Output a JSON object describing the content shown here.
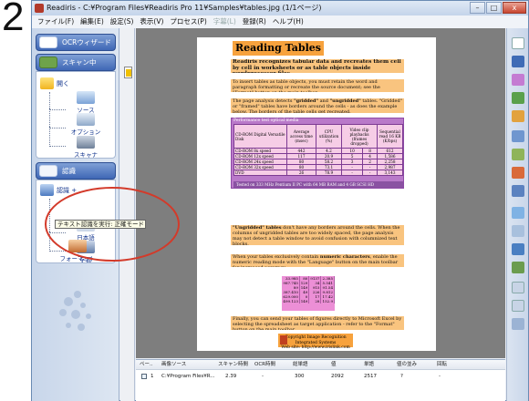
{
  "step_number": "2",
  "window": {
    "title": "Readiris - C:¥Program Files¥Readiris Pro 11¥Samples¥tables.jpg (1/1ページ)",
    "buttons": {
      "minimize": "–",
      "maximize": "□",
      "close": "x"
    }
  },
  "menu": {
    "items": [
      {
        "label": "ファイル(F)"
      },
      {
        "label": "編集(E)"
      },
      {
        "label": "設定(S)"
      },
      {
        "label": "表示(V)"
      },
      {
        "label": "プロセス(P)"
      },
      {
        "label": "字幕(L)"
      },
      {
        "label": "登録(R)"
      },
      {
        "label": "ヘルプ(H)"
      }
    ]
  },
  "left_panel": {
    "ocr_wizard": "OCRウィザード",
    "scan_section": "スキャン中",
    "scan_open": "開く",
    "scan_tree": [
      "ソース",
      "オプション",
      "スキャナ"
    ],
    "recognize_section": "認識",
    "recognize_button": "認識 +",
    "recognize_tree": [
      "日本語",
      "学習"
    ],
    "format_item": "フォーマット",
    "tooltip": "テキスト認識を実行: 正確モード"
  },
  "document": {
    "title": "Reading Tables",
    "intro": "Readiris recognizes tabular data and recreates them cell by cell in worksheets or as table objects inside wordprocessor files.",
    "para1": "To insert tables as table objects, you must retain the word and paragraph formatting or recreate the source document; see the \"Format\" button on the main toolbar.",
    "para2_a": "The page analysis detects ",
    "para2_b": "\"gridded\"",
    "para2_c": " and ",
    "para2_d": "\"ungridded\"",
    "para2_e": " tables. \"Gridded\" or \"framed\" tables have borders around the cells - as does the example below. The borders of the table cells get recreated.",
    "table": {
      "caption": "Performance test optical media",
      "headers": [
        "CD-ROM Digital Versatile Disk",
        "Average access time (msec)",
        "CPU utilization (%)",
        "Video clip playbacks (frames dropped)",
        "",
        "Sequential read 16 KB (K/bps)"
      ],
      "rows": [
        [
          "CD-ROM 8x speed",
          "442",
          "4.2",
          "10",
          "8",
          "612"
        ],
        [
          "CD-ROM 12x speed",
          "117",
          "20.9",
          "5",
          "4",
          "1,586"
        ],
        [
          "CD-ROM 24x speed",
          "80",
          "58.2",
          "3",
          "2",
          "2,258"
        ],
        [
          "CD-ROM 32x speed",
          "80",
          "73.1",
          "-",
          "-",
          "2,987"
        ],
        [
          "DVD",
          "26",
          "78.9",
          "-",
          "-",
          "3,143"
        ]
      ],
      "footer": "Tested on 333 MHz Pentium II PC with 64 MB RAM and 4 GB SCSI HD"
    },
    "para3_a": "\"Ungridded\" tables",
    "para3_b": " don't have any borders around the cells. When the columns of ungridded tables are too widely spaced, the page analysis may not detect a table window to avoid confusion with columnized text blocks.",
    "para4_a": "When your tables exclusively contain ",
    "para4_b": "numeric characters",
    "para4_c": ", enable the numeric reading mode with the \"Language\" button on the main toolbar for increased accuracy.",
    "numbers": [
      [
        "33.985",
        "80",
        "9137",
        "2.385"
      ],
      [
        "987.745",
        "129",
        "34",
        "5.541"
      ],
      [
        "89",
        "149",
        "915",
        "91.54"
      ],
      [
        "387.410",
        "49",
        "226",
        "9.812"
      ],
      [
        "629.000",
        "0",
        "17",
        "17.42"
      ],
      [
        "499.123",
        "149",
        "28",
        "152.9"
      ]
    ],
    "para5": "Finally, you can send your tables of figures directly to Microsoft Excel by selecting the spreadsheet as target application - refer to the \"Format\" button on the main toolbar.",
    "footer_line1": "Copyright Image Recognition Integrated Systems",
    "footer_line2": "Web site: http://www.irislink.com"
  },
  "results": {
    "headers": [
      "ペー..",
      "画像ソース",
      "スキャン時間",
      "OCR時間",
      "総単語",
      "値",
      "単語",
      "値の並み",
      "回転"
    ],
    "row": [
      "1",
      "C:¥Program Files¥R...",
      "2.39",
      "-",
      "300",
      "2092",
      "2517",
      "?",
      "-"
    ]
  }
}
